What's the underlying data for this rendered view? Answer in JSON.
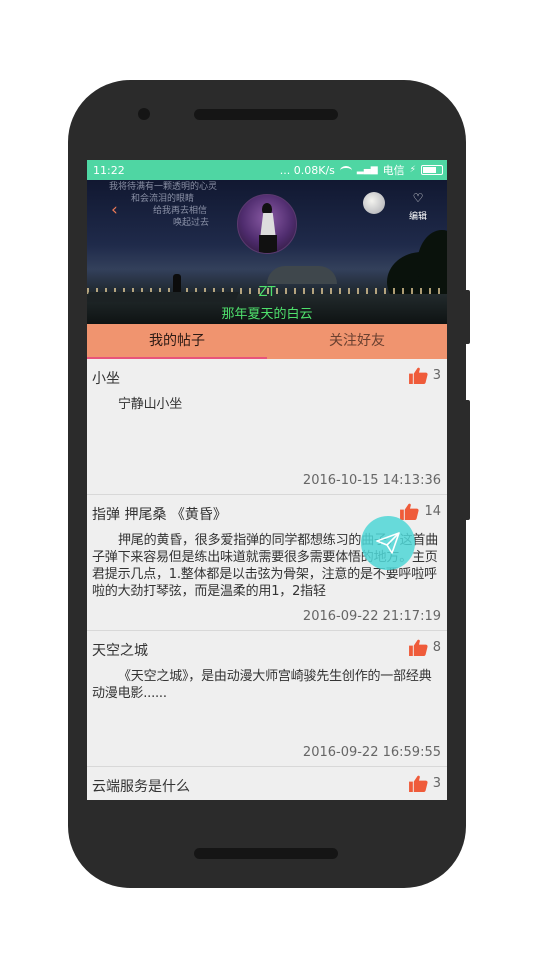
{
  "status_bar": {
    "time": "11:22",
    "network_speed": "... 0.08K/s",
    "carrier": "电信"
  },
  "header": {
    "poem_lines": [
      "我将待满有一颗透明的心灵",
      "和会流泪的眼睛",
      "给我再去相信",
      "唤起过去"
    ],
    "avatar_caption": "",
    "edit_label": "编辑",
    "user_name": "ZT",
    "user_signature": "那年夏天的白云"
  },
  "tabs": [
    {
      "label": "我的帖子",
      "active": true
    },
    {
      "label": "关注好友",
      "active": false
    }
  ],
  "posts": [
    {
      "title": "小坐",
      "likes": "3",
      "body": "宁静山小坐",
      "time": "2016-10-15 14:13:36"
    },
    {
      "title": "指弹 押尾桑 《黄昏》",
      "likes": "14",
      "body": "押尾的黄昏，很多爱指弹的同学都想练习的曲子，这首曲子弹下来容易但是练出味道就需要很多需要体悟的地方。主页君提示几点，1.整体都是以击弦为骨架，注意的是不要呼啦呼啦的大劲打琴弦，而是温柔的用1，2指轻",
      "time": "2016-09-22 21:17:19"
    },
    {
      "title": "天空之城",
      "likes": "8",
      "body": "《天空之城》，是由动漫大师宫崎骏先生创作的一部经典动漫电影......",
      "time": "2016-09-22 16:59:55"
    },
    {
      "title": "云端服务是什么",
      "likes": "3",
      "body": "",
      "time": ""
    }
  ],
  "colors": {
    "status_bar": "#4fd6a3",
    "tab_bar": "#f0946f",
    "tab_indicator": "#e8547a",
    "thumb": "#ef5b3a",
    "fab": "#4fd6d6",
    "user_text": "#4fe06c"
  }
}
